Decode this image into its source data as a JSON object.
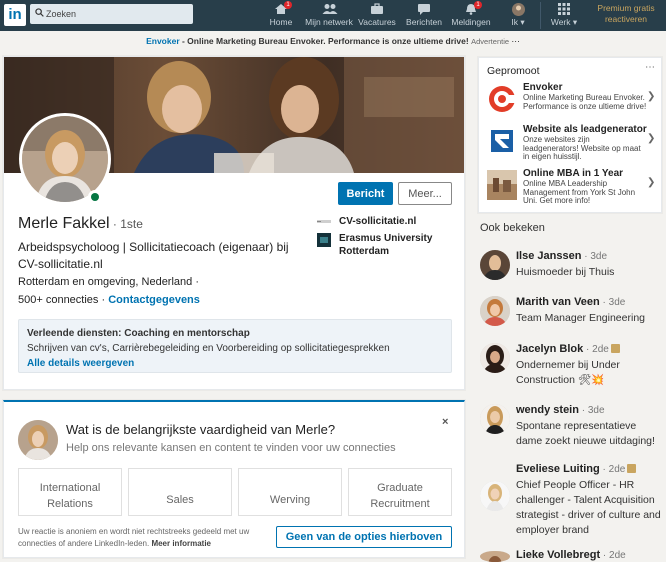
{
  "nav": {
    "search_placeholder": "Zoeken",
    "items": [
      {
        "label": "Home",
        "icon": "home-icon",
        "badge": "1"
      },
      {
        "label": "Mijn netwerk",
        "icon": "network-icon"
      },
      {
        "label": "Vacatures",
        "icon": "jobs-icon"
      },
      {
        "label": "Berichten",
        "icon": "messages-icon"
      },
      {
        "label": "Meldingen",
        "icon": "notifications-icon",
        "badge": "1"
      },
      {
        "label": "Ik",
        "icon": "me-avatar"
      },
      {
        "label": "Werk",
        "icon": "grid-icon"
      }
    ],
    "premium": "Premium gratis reactiveren",
    "brand_color": "#283e4a"
  },
  "ad": {
    "brand": "Envoker",
    "text": " - Online Marketing Bureau Envoker. Performance is onze ultieme drive!",
    "tag": "Advertentie",
    "more": "⋯"
  },
  "profile": {
    "name": "Merle Fakkel",
    "degree": " · 1ste",
    "headline": "Arbeidspsycholoog | Sollicitatiecoach (eigenaar) bij CV-sollicitatie.nl",
    "location": "Rotterdam en omgeving, Nederland",
    "location_sep": " ·",
    "connections": "500+ connecties",
    "conn_sep": " · ",
    "contact": "Contactgegevens",
    "message_button": "Bericht",
    "more_button": "Meer...",
    "links": [
      "CV-sollicitatie.nl",
      "Erasmus University Rotterdam"
    ],
    "services_title": "Verleende diensten: Coaching en mentorschap",
    "services_desc": "Schrijven van cv's, Carrièrebegeleiding en Voorbereiding op sollicitatiegesprekken",
    "services_link": "Alle details weergeven"
  },
  "skill": {
    "question": "Wat is de belangrijkste vaardigheid van Merle?",
    "subtitle": "Help ons relevante kansen en content te vinden voor uw connecties",
    "close": "×",
    "options": [
      "International Relations",
      "Sales",
      "Werving",
      "Graduate Recruitment"
    ],
    "fine_print": "Uw reactie is anoniem en wordt niet rechtstreeks gedeeld met uw connecties of andere LinkedIn-leden.",
    "fine_link": "Meer informatie",
    "none_button": "Geen van de opties hierboven"
  },
  "promoted": {
    "title": "Gepromoot",
    "more": "⋯",
    "items": [
      {
        "name": "Envoker",
        "desc": "Online Marketing Bureau Envoker. Performance is onze ultieme drive!"
      },
      {
        "name": "Website als leadgenerator",
        "desc": "Onze websites zijn leadgenerators! Website op maat in eigen huisstijl."
      },
      {
        "name": "Online MBA in 1 Year",
        "desc": "Online MBA Leadership Management from York St John Uni. Get more info!"
      }
    ]
  },
  "also_viewed": {
    "title": "Ook bekeken",
    "people": [
      {
        "name": "Ilse Janssen",
        "degree": " · 3de",
        "headline": "Huismoeder bij Thuis"
      },
      {
        "name": "Marith van Veen",
        "degree": " · 3de",
        "headline": "Team Manager Engineering"
      },
      {
        "name": "Jacelyn Blok",
        "degree": " · 2de",
        "headline": "Ondernemer bij Under Construction 🛠💥"
      },
      {
        "name": "wendy stein",
        "degree": " · 3de",
        "headline": "Spontane representatieve dame zoekt nieuwe uitdaging!"
      },
      {
        "name": "Eveliese Luiting",
        "degree": " · 2de",
        "headline": "Chief People Officer - HR challenger - Talent Acquisition strategist - driver of culture and employer brand"
      },
      {
        "name": "Lieke Vollebregt",
        "degree": " · 2de",
        "headline": ""
      }
    ]
  }
}
